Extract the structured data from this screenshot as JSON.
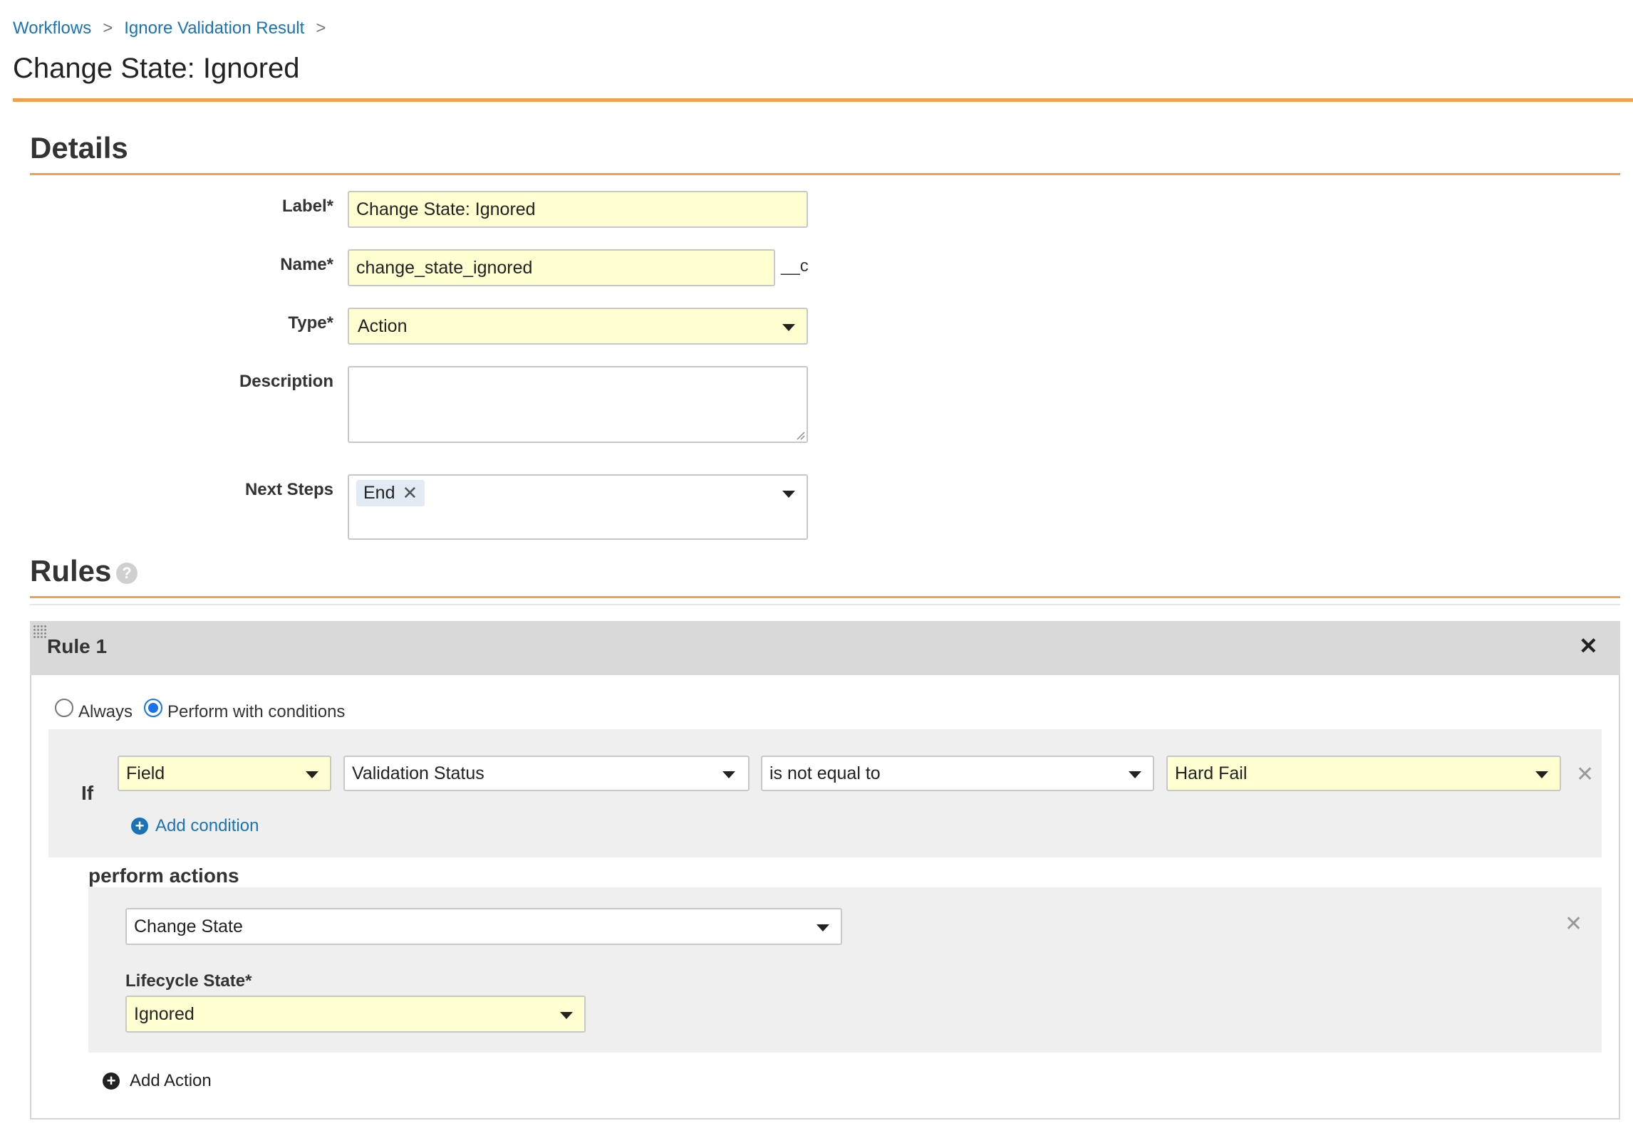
{
  "breadcrumb": {
    "items": [
      "Workflows",
      "Ignore Validation Result"
    ],
    "separator": ">"
  },
  "page_title": "Change State: Ignored",
  "details": {
    "heading": "Details",
    "label_field": {
      "label": "Label*",
      "value": "Change State: Ignored"
    },
    "name_field": {
      "label": "Name*",
      "value": "change_state_ignored",
      "suffix": "__c"
    },
    "type_field": {
      "label": "Type*",
      "value": "Action"
    },
    "description_field": {
      "label": "Description",
      "value": ""
    },
    "next_steps_field": {
      "label": "Next Steps",
      "tokens": [
        "End"
      ]
    }
  },
  "rules": {
    "heading": "Rules",
    "rule": {
      "title": "Rule 1",
      "mode_options": [
        "Always",
        "Perform with conditions"
      ],
      "selected_mode": "Perform with conditions",
      "if_label": "If",
      "condition": {
        "source": "Field",
        "field": "Validation Status",
        "operator": "is not equal to",
        "value": "Hard Fail"
      },
      "add_condition_label": "Add condition",
      "perform_actions_label": "perform actions",
      "action": {
        "type": "Change State",
        "lifecycle_state_label": "Lifecycle State*",
        "lifecycle_state_value": "Ignored"
      },
      "add_action_label": "Add Action"
    }
  },
  "icons": {
    "close": "close-icon",
    "help": "help-icon",
    "caret": "caret-down-icon"
  },
  "colors": {
    "accent_orange": "#f0a050",
    "link_blue": "#1a73b5",
    "required_field_yellow": "#ffffd2"
  }
}
